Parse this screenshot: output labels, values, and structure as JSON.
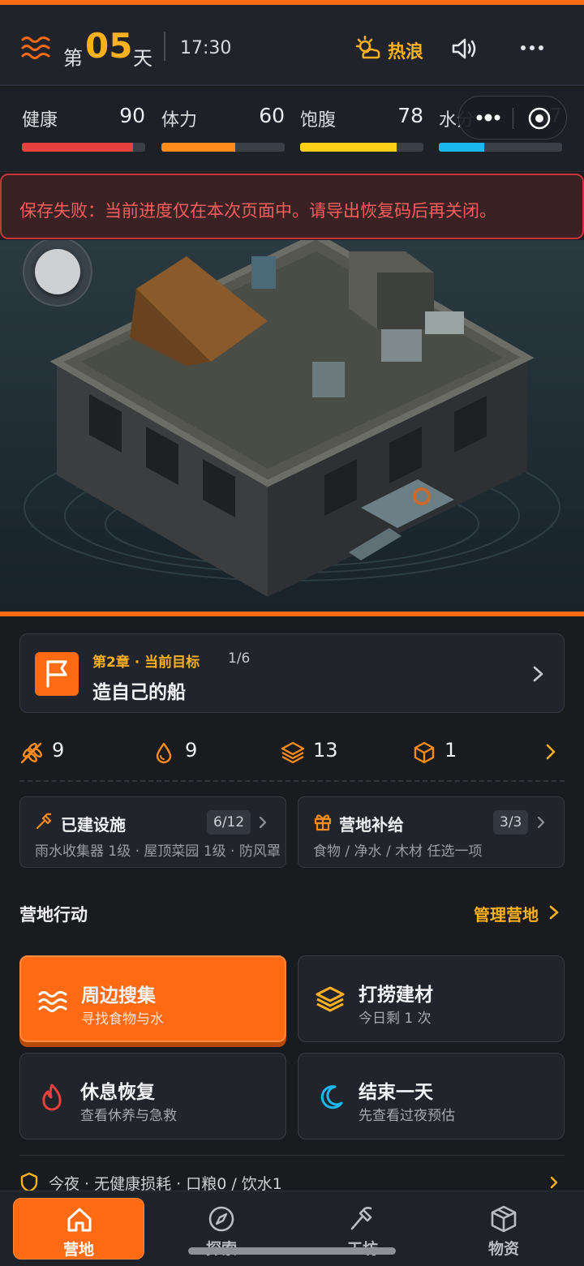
{
  "header": {
    "day_prefix": "第",
    "day_number": "05",
    "day_suffix": "天",
    "time": "17:30",
    "weather_label": "热浪",
    "icons": [
      "wave-icon",
      "sun-cloud-icon",
      "speaker-icon",
      "more-icon"
    ]
  },
  "stats": [
    {
      "label": "健康",
      "value": "90",
      "fill": 0.9,
      "color": "#e8403f"
    },
    {
      "label": "体力",
      "value": "60",
      "fill": 0.6,
      "color": "#ff8c1a"
    },
    {
      "label": "饱腹",
      "value": "78",
      "fill": 0.78,
      "color": "#ffcf1a"
    },
    {
      "label": "水分",
      "value": "37",
      "fill": 0.37,
      "color": "#19b8f0"
    }
  ],
  "error_banner": "保存失败：当前进度仅在本次页面中。请导出恢复码后再关闭。",
  "goal": {
    "chapter": "第2章 · 当前目标",
    "progress": "1/6",
    "title": "造自己的船"
  },
  "resources": [
    {
      "icon": "grain-icon",
      "value": "9"
    },
    {
      "icon": "water-drop-icon",
      "value": "9"
    },
    {
      "icon": "layers-icon",
      "value": "13"
    },
    {
      "icon": "box-icon",
      "value": "1"
    }
  ],
  "facilities": {
    "title": "已建设施",
    "badge": "6/12",
    "subtitle": "雨水收集器 1级 · 屋顶菜园 1级 · 防风罩"
  },
  "supplies": {
    "title": "营地补给",
    "badge": "3/3",
    "subtitle": "食物 / 净水 / 木材 任选一项"
  },
  "actions_section": {
    "title": "营地行动",
    "manage_link": "管理营地"
  },
  "actions": [
    {
      "title": "周边搜集",
      "subtitle": "寻找食物与水",
      "icon": "wave-icon",
      "primary": true
    },
    {
      "title": "打捞建材",
      "subtitle": "今日剩 1 次",
      "icon": "layers-icon",
      "primary": false
    },
    {
      "title": "休息恢复",
      "subtitle": "查看休养与急救",
      "icon": "flame-icon",
      "primary": false
    },
    {
      "title": "结束一天",
      "subtitle": "先查看过夜预估",
      "icon": "moon-icon",
      "primary": false
    }
  ],
  "night_summary": "今夜 · 无健康损耗 · 口粮0 / 饮水1",
  "tabs": [
    {
      "label": "营地",
      "icon": "home-icon",
      "active": true
    },
    {
      "label": "探索",
      "icon": "compass-icon",
      "active": false
    },
    {
      "label": "工坊",
      "icon": "hammer-icon",
      "active": false
    },
    {
      "label": "物资",
      "icon": "crate-icon",
      "active": false
    }
  ],
  "colors": {
    "accent": "#ff6a12",
    "gold": "#ffb01f",
    "error": "#ff5c5c",
    "panel": "#21242b",
    "background": "#191b1f"
  }
}
